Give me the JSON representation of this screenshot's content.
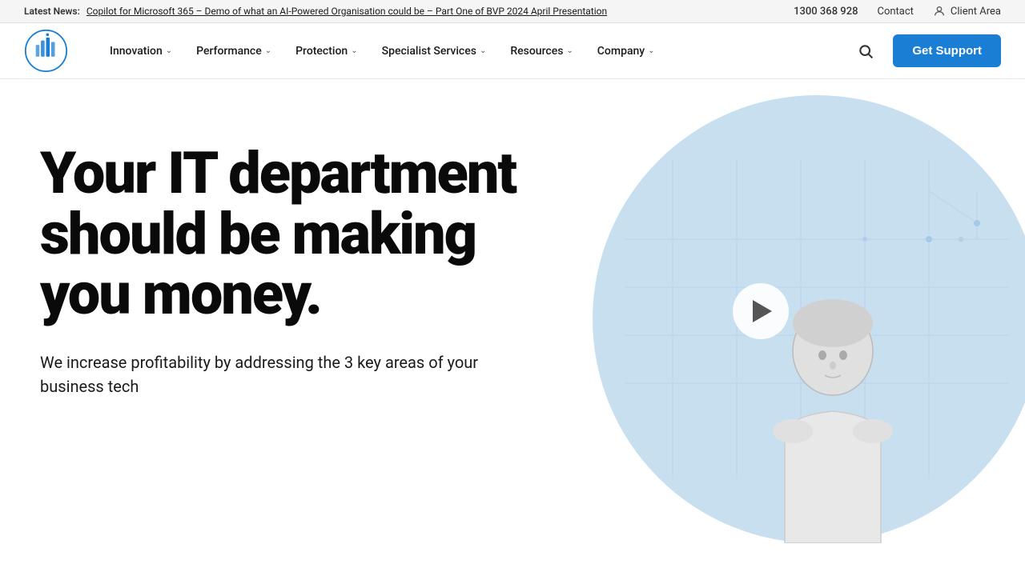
{
  "topbar": {
    "latest_label": "Latest News:",
    "news_link": "Copilot for Microsoft 365 – Demo of what an AI-Powered Organisation could be – Part One of BVP 2024 April Presentation",
    "phone": "1300 368 928",
    "contact": "Contact",
    "client_area": "Client Area"
  },
  "nav": {
    "brand_alt": "BVP Logo",
    "items": [
      {
        "label": "Innovation",
        "has_dropdown": true
      },
      {
        "label": "Performance",
        "has_dropdown": true
      },
      {
        "label": "Protection",
        "has_dropdown": true
      },
      {
        "label": "Specialist Services",
        "has_dropdown": true
      },
      {
        "label": "Resources",
        "has_dropdown": true
      },
      {
        "label": "Company",
        "has_dropdown": true
      }
    ],
    "get_support": "Get Support"
  },
  "hero": {
    "title": "Your IT department should be making you money.",
    "subtitle": "We increase profitability by addressing the 3 key areas of your business tech"
  },
  "colors": {
    "brand_blue": "#1a7fd4",
    "hero_bg": "#d6e8f5",
    "illustration_circle": "#c8dff0"
  }
}
